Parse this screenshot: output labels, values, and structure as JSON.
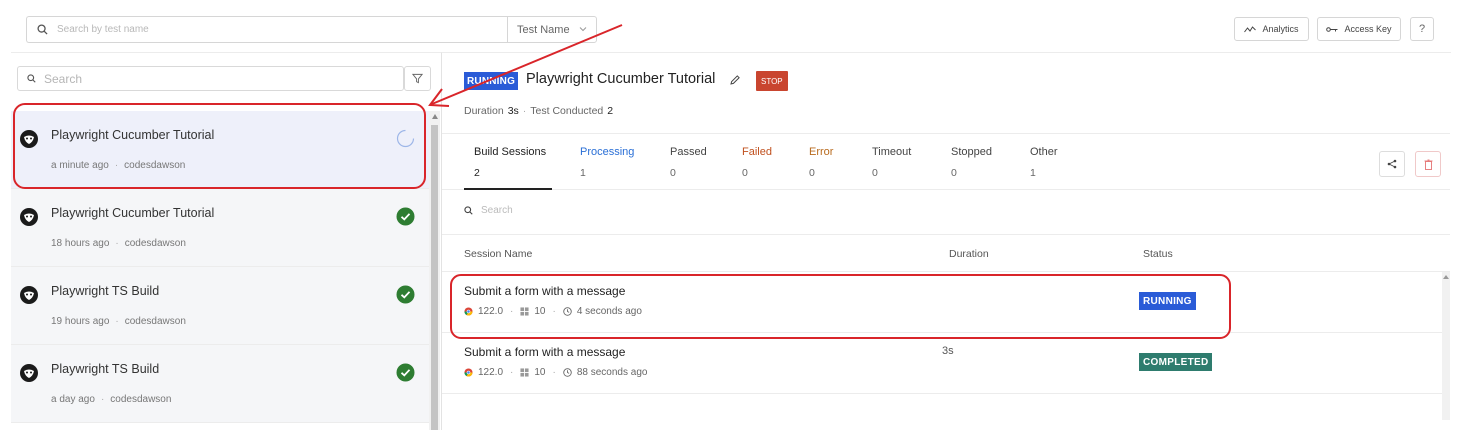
{
  "colors": {
    "running": "#2a5bd7",
    "completed": "#2e7c6e",
    "stop": "#c9452f",
    "passed_icon": "#2e7d32",
    "processing_tab": "#2a6fd6",
    "failed_tab": "#c0501e",
    "error_tab": "#b86a1d",
    "annotation": "#d9252a"
  },
  "topbar": {
    "search_placeholder": "Search by test name",
    "filter_select": "Test Name",
    "analytics_label": "Analytics",
    "access_key_label": "Access Key",
    "help_label": "?"
  },
  "sidebar": {
    "search_placeholder": "Search",
    "builds": [
      {
        "name": "Playwright Cucumber Tutorial",
        "time": "a minute ago",
        "user": "codesdawson",
        "status": "running"
      },
      {
        "name": "Playwright Cucumber Tutorial",
        "time": "18 hours ago",
        "user": "codesdawson",
        "status": "passed"
      },
      {
        "name": "Playwright TS Build",
        "time": "19 hours ago",
        "user": "codesdawson",
        "status": "passed"
      },
      {
        "name": "Playwright TS Build",
        "time": "a day ago",
        "user": "codesdawson",
        "status": "passed"
      }
    ]
  },
  "build": {
    "status_badge": "RUNNING",
    "title": "Playwright Cucumber Tutorial",
    "stop_label": "STOP",
    "duration_label": "Duration",
    "duration_value": "3s",
    "tests_label": "Test Conducted",
    "tests_value": "2"
  },
  "tabs": [
    {
      "label": "Build Sessions",
      "count": "2"
    },
    {
      "label": "Processing",
      "count": "1"
    },
    {
      "label": "Passed",
      "count": "0"
    },
    {
      "label": "Failed",
      "count": "0"
    },
    {
      "label": "Error",
      "count": "0"
    },
    {
      "label": "Timeout",
      "count": "0"
    },
    {
      "label": "Stopped",
      "count": "0"
    },
    {
      "label": "Other",
      "count": "1"
    }
  ],
  "sessions": {
    "search_placeholder": "Search",
    "headers": {
      "name": "Session Name",
      "duration": "Duration",
      "status": "Status"
    },
    "rows": [
      {
        "name": "Submit a form with a message",
        "browser": "122.0",
        "os": "10",
        "ago": "4 seconds ago",
        "duration": "",
        "status": "RUNNING"
      },
      {
        "name": "Submit a form with a message",
        "browser": "122.0",
        "os": "10",
        "ago": "88 seconds ago",
        "duration": "3s",
        "status": "COMPLETED"
      }
    ]
  }
}
